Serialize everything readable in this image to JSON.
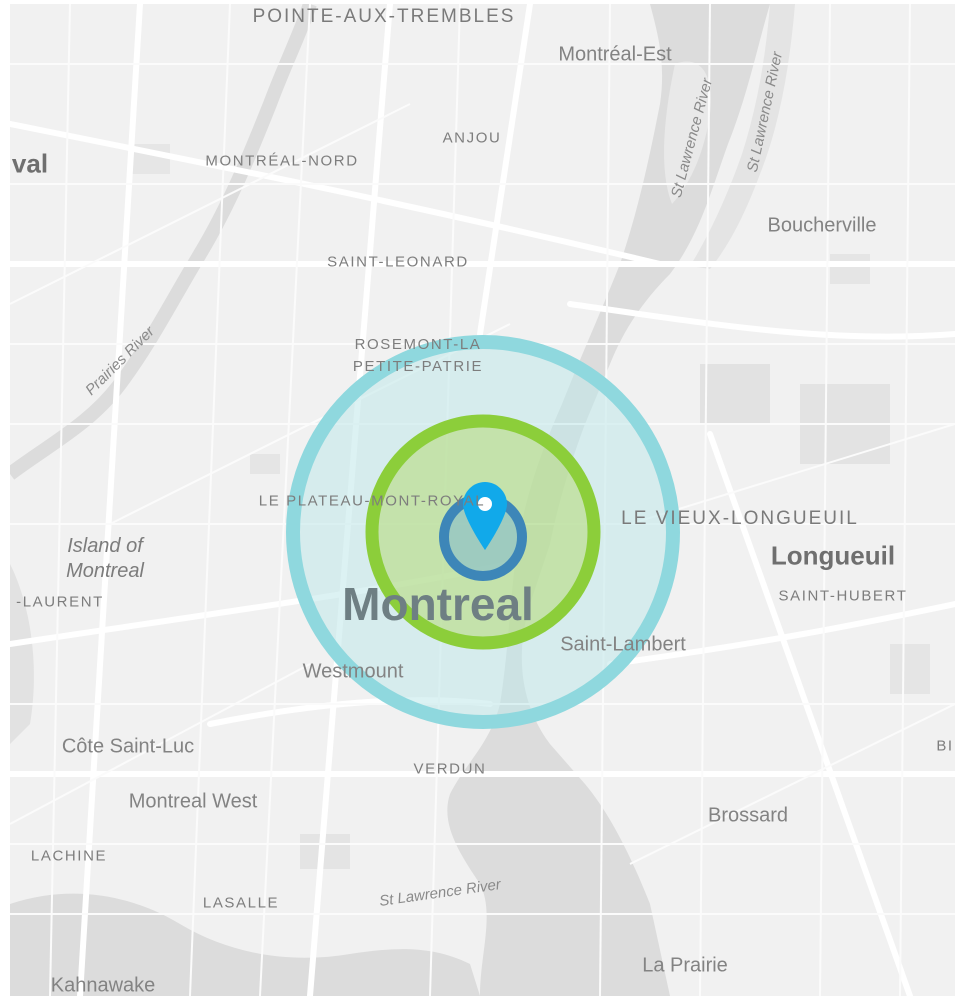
{
  "map": {
    "labels": {
      "pointe_aux_trembles": "POINTE-AUX-TREMBLES",
      "montreal_est": "Montréal-Est",
      "anjou": "ANJOU",
      "laval_partial": "val",
      "montreal_nord": "MONTRÉAL-NORD",
      "boucherville": "Boucherville",
      "saint_leonard": "SAINT-LEONARD",
      "rosemont_line1": "ROSEMONT-LA",
      "rosemont_line2": "PETITE-PATRIE",
      "plateau": "LE PLATEAU-MONT-ROYAL",
      "vieux_longueuil": "LE VIEUX-LONGUEUIL",
      "longueuil": "Longueuil",
      "saint_hubert": "SAINT-HUBERT",
      "island_line1": "Island of",
      "island_line2": "Montreal",
      "saint_laurent_partial": "-LAURENT",
      "montreal": "Montreal",
      "saint_lambert": "Saint-Lambert",
      "westmount": "Westmount",
      "cote_saint_luc": "Côte Saint-Luc",
      "verdun": "VERDUN",
      "montreal_west": "Montreal West",
      "brossard": "Brossard",
      "lachine": "LACHINE",
      "lasalle": "LASALLE",
      "la_prairie": "La Prairie",
      "kahnawake": "Kahnawake",
      "edge_partial": "BI"
    },
    "rivers": {
      "st_lawrence_1": "St Lawrence River",
      "st_lawrence_2": "St Lawrence River",
      "st_lawrence_3": "St Lawrence River",
      "prairies": "Prairies River"
    },
    "radius_rings": [
      {
        "level": "outer",
        "color": "#8fd8de"
      },
      {
        "level": "middle",
        "color": "#8cce3a"
      },
      {
        "level": "inner",
        "color": "#3d86b8"
      }
    ],
    "marker": {
      "icon": "map-pin-icon",
      "color": "#11a9ea"
    },
    "colors": {
      "land": "#f1f1f1",
      "water": "#dcdcdc",
      "roads": "#ffffff"
    }
  }
}
